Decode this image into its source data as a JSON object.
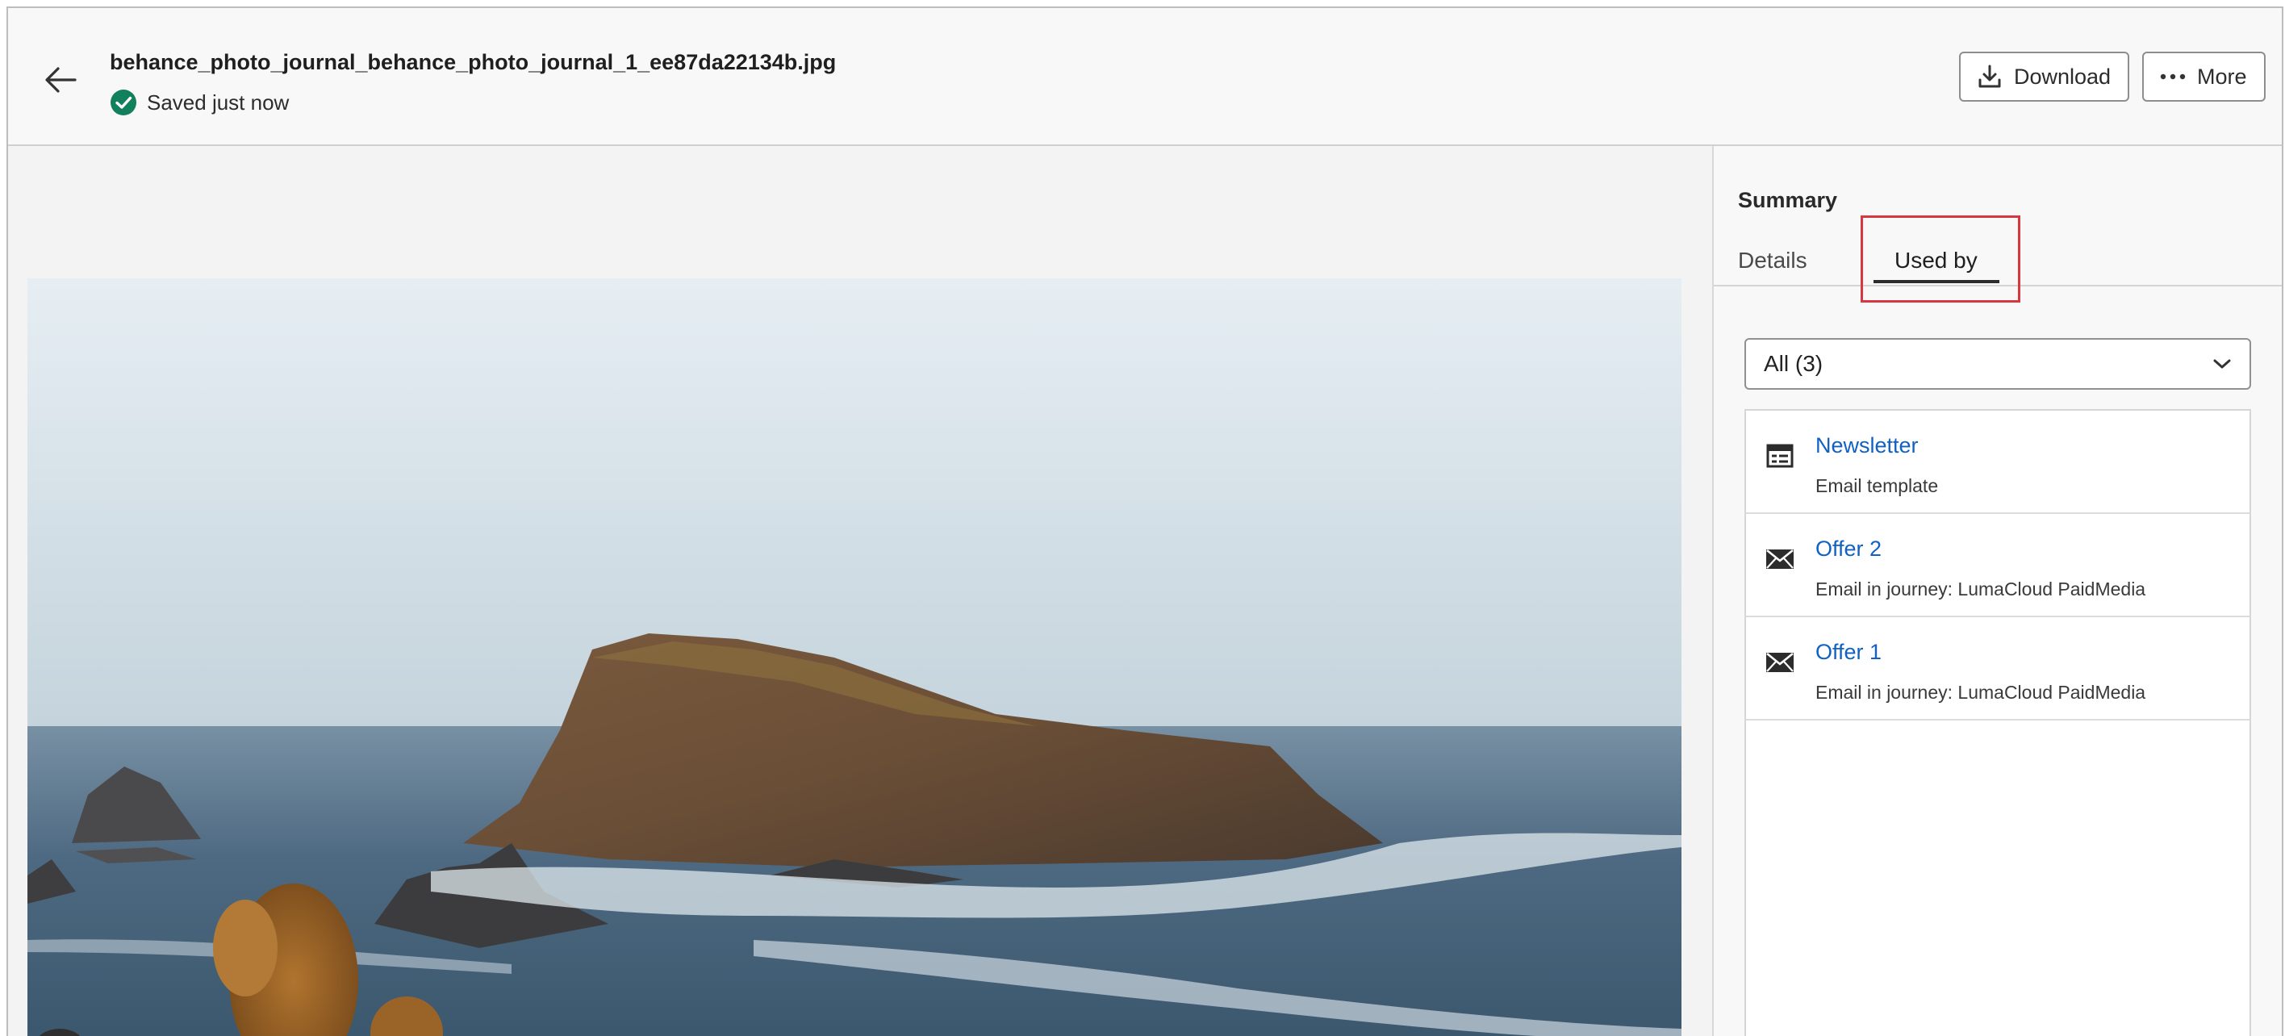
{
  "header": {
    "file_name": "behance_photo_journal_behance_photo_journal_1_ee87da22134b.jpg",
    "save_status": "Saved just now",
    "download_label": "Download",
    "more_label": "More"
  },
  "panel": {
    "title": "Summary",
    "tabs": [
      {
        "label": "Details",
        "active": false
      },
      {
        "label": "Used by",
        "active": true
      }
    ],
    "filter": {
      "selected": "All (3)"
    },
    "items": [
      {
        "name": "Newsletter",
        "type": "Email template",
        "icon": "template-icon"
      },
      {
        "name": "Offer 2",
        "type": "Email in journey: LumaCloud PaidMedia",
        "icon": "email-icon"
      },
      {
        "name": "Offer 1",
        "type": "Email in journey: LumaCloud PaidMedia",
        "icon": "email-icon"
      }
    ]
  },
  "colors": {
    "link": "#1160c4",
    "success": "#12805c",
    "highlight": "#d7373f"
  }
}
